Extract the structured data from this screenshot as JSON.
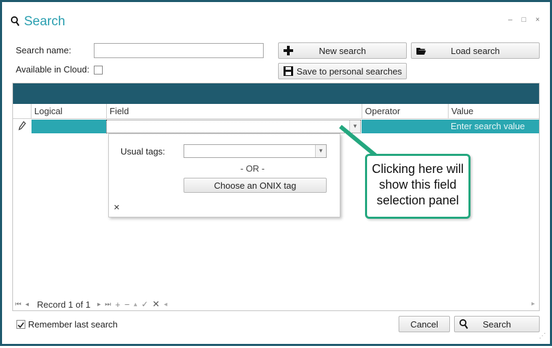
{
  "window": {
    "title": "Search",
    "controls": [
      "–",
      "□",
      "×"
    ]
  },
  "form": {
    "search_name_label": "Search name:",
    "search_name_value": "",
    "available_in_cloud_label": "Available in Cloud:",
    "available_in_cloud_checked": false
  },
  "toolbar": {
    "new_search_label": "New search",
    "load_search_label": "Load search",
    "save_personal_label": "Save to personal searches"
  },
  "grid": {
    "columns": [
      "Logical",
      "Field",
      "Operator",
      "Value"
    ],
    "row": {
      "value_placeholder": "Enter search value"
    }
  },
  "field_panel": {
    "usual_tags_label": "Usual tags:",
    "usual_tags_value": "",
    "or_text": "- OR -",
    "choose_onix_label": "Choose an ONIX tag",
    "close_glyph": "×"
  },
  "navigator": {
    "record_text": "Record 1 of 1"
  },
  "callout": {
    "line1": "Clicking here will",
    "line2": "show this field",
    "line3": "selection panel"
  },
  "footer": {
    "remember_label": "Remember last search",
    "remember_checked": true,
    "cancel_label": "Cancel",
    "search_label": "Search"
  },
  "colors": {
    "accent": "#2a9fb0",
    "grid_band": "#1f5a6e",
    "row_highlight": "#2aa7b1",
    "callout_border": "#24a77f"
  }
}
